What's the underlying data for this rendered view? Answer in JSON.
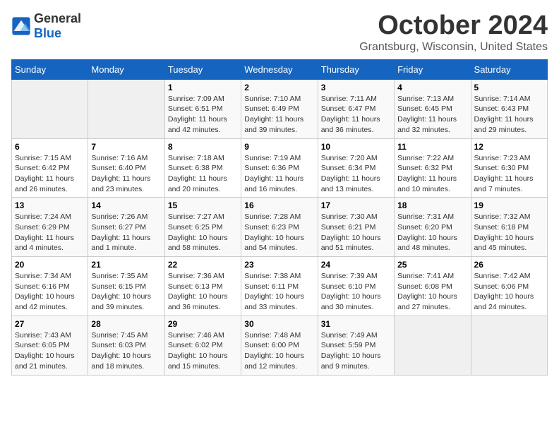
{
  "header": {
    "logo_general": "General",
    "logo_blue": "Blue",
    "month_title": "October 2024",
    "subtitle": "Grantsburg, Wisconsin, United States"
  },
  "days_of_week": [
    "Sunday",
    "Monday",
    "Tuesday",
    "Wednesday",
    "Thursday",
    "Friday",
    "Saturday"
  ],
  "weeks": [
    [
      {
        "day": "",
        "sunrise": "",
        "sunset": "",
        "daylight": ""
      },
      {
        "day": "",
        "sunrise": "",
        "sunset": "",
        "daylight": ""
      },
      {
        "day": "1",
        "sunrise": "Sunrise: 7:09 AM",
        "sunset": "Sunset: 6:51 PM",
        "daylight": "Daylight: 11 hours and 42 minutes."
      },
      {
        "day": "2",
        "sunrise": "Sunrise: 7:10 AM",
        "sunset": "Sunset: 6:49 PM",
        "daylight": "Daylight: 11 hours and 39 minutes."
      },
      {
        "day": "3",
        "sunrise": "Sunrise: 7:11 AM",
        "sunset": "Sunset: 6:47 PM",
        "daylight": "Daylight: 11 hours and 36 minutes."
      },
      {
        "day": "4",
        "sunrise": "Sunrise: 7:13 AM",
        "sunset": "Sunset: 6:45 PM",
        "daylight": "Daylight: 11 hours and 32 minutes."
      },
      {
        "day": "5",
        "sunrise": "Sunrise: 7:14 AM",
        "sunset": "Sunset: 6:43 PM",
        "daylight": "Daylight: 11 hours and 29 minutes."
      }
    ],
    [
      {
        "day": "6",
        "sunrise": "Sunrise: 7:15 AM",
        "sunset": "Sunset: 6:42 PM",
        "daylight": "Daylight: 11 hours and 26 minutes."
      },
      {
        "day": "7",
        "sunrise": "Sunrise: 7:16 AM",
        "sunset": "Sunset: 6:40 PM",
        "daylight": "Daylight: 11 hours and 23 minutes."
      },
      {
        "day": "8",
        "sunrise": "Sunrise: 7:18 AM",
        "sunset": "Sunset: 6:38 PM",
        "daylight": "Daylight: 11 hours and 20 minutes."
      },
      {
        "day": "9",
        "sunrise": "Sunrise: 7:19 AM",
        "sunset": "Sunset: 6:36 PM",
        "daylight": "Daylight: 11 hours and 16 minutes."
      },
      {
        "day": "10",
        "sunrise": "Sunrise: 7:20 AM",
        "sunset": "Sunset: 6:34 PM",
        "daylight": "Daylight: 11 hours and 13 minutes."
      },
      {
        "day": "11",
        "sunrise": "Sunrise: 7:22 AM",
        "sunset": "Sunset: 6:32 PM",
        "daylight": "Daylight: 11 hours and 10 minutes."
      },
      {
        "day": "12",
        "sunrise": "Sunrise: 7:23 AM",
        "sunset": "Sunset: 6:30 PM",
        "daylight": "Daylight: 11 hours and 7 minutes."
      }
    ],
    [
      {
        "day": "13",
        "sunrise": "Sunrise: 7:24 AM",
        "sunset": "Sunset: 6:29 PM",
        "daylight": "Daylight: 11 hours and 4 minutes."
      },
      {
        "day": "14",
        "sunrise": "Sunrise: 7:26 AM",
        "sunset": "Sunset: 6:27 PM",
        "daylight": "Daylight: 11 hours and 1 minute."
      },
      {
        "day": "15",
        "sunrise": "Sunrise: 7:27 AM",
        "sunset": "Sunset: 6:25 PM",
        "daylight": "Daylight: 10 hours and 58 minutes."
      },
      {
        "day": "16",
        "sunrise": "Sunrise: 7:28 AM",
        "sunset": "Sunset: 6:23 PM",
        "daylight": "Daylight: 10 hours and 54 minutes."
      },
      {
        "day": "17",
        "sunrise": "Sunrise: 7:30 AM",
        "sunset": "Sunset: 6:21 PM",
        "daylight": "Daylight: 10 hours and 51 minutes."
      },
      {
        "day": "18",
        "sunrise": "Sunrise: 7:31 AM",
        "sunset": "Sunset: 6:20 PM",
        "daylight": "Daylight: 10 hours and 48 minutes."
      },
      {
        "day": "19",
        "sunrise": "Sunrise: 7:32 AM",
        "sunset": "Sunset: 6:18 PM",
        "daylight": "Daylight: 10 hours and 45 minutes."
      }
    ],
    [
      {
        "day": "20",
        "sunrise": "Sunrise: 7:34 AM",
        "sunset": "Sunset: 6:16 PM",
        "daylight": "Daylight: 10 hours and 42 minutes."
      },
      {
        "day": "21",
        "sunrise": "Sunrise: 7:35 AM",
        "sunset": "Sunset: 6:15 PM",
        "daylight": "Daylight: 10 hours and 39 minutes."
      },
      {
        "day": "22",
        "sunrise": "Sunrise: 7:36 AM",
        "sunset": "Sunset: 6:13 PM",
        "daylight": "Daylight: 10 hours and 36 minutes."
      },
      {
        "day": "23",
        "sunrise": "Sunrise: 7:38 AM",
        "sunset": "Sunset: 6:11 PM",
        "daylight": "Daylight: 10 hours and 33 minutes."
      },
      {
        "day": "24",
        "sunrise": "Sunrise: 7:39 AM",
        "sunset": "Sunset: 6:10 PM",
        "daylight": "Daylight: 10 hours and 30 minutes."
      },
      {
        "day": "25",
        "sunrise": "Sunrise: 7:41 AM",
        "sunset": "Sunset: 6:08 PM",
        "daylight": "Daylight: 10 hours and 27 minutes."
      },
      {
        "day": "26",
        "sunrise": "Sunrise: 7:42 AM",
        "sunset": "Sunset: 6:06 PM",
        "daylight": "Daylight: 10 hours and 24 minutes."
      }
    ],
    [
      {
        "day": "27",
        "sunrise": "Sunrise: 7:43 AM",
        "sunset": "Sunset: 6:05 PM",
        "daylight": "Daylight: 10 hours and 21 minutes."
      },
      {
        "day": "28",
        "sunrise": "Sunrise: 7:45 AM",
        "sunset": "Sunset: 6:03 PM",
        "daylight": "Daylight: 10 hours and 18 minutes."
      },
      {
        "day": "29",
        "sunrise": "Sunrise: 7:46 AM",
        "sunset": "Sunset: 6:02 PM",
        "daylight": "Daylight: 10 hours and 15 minutes."
      },
      {
        "day": "30",
        "sunrise": "Sunrise: 7:48 AM",
        "sunset": "Sunset: 6:00 PM",
        "daylight": "Daylight: 10 hours and 12 minutes."
      },
      {
        "day": "31",
        "sunrise": "Sunrise: 7:49 AM",
        "sunset": "Sunset: 5:59 PM",
        "daylight": "Daylight: 10 hours and 9 minutes."
      },
      {
        "day": "",
        "sunrise": "",
        "sunset": "",
        "daylight": ""
      },
      {
        "day": "",
        "sunrise": "",
        "sunset": "",
        "daylight": ""
      }
    ]
  ]
}
